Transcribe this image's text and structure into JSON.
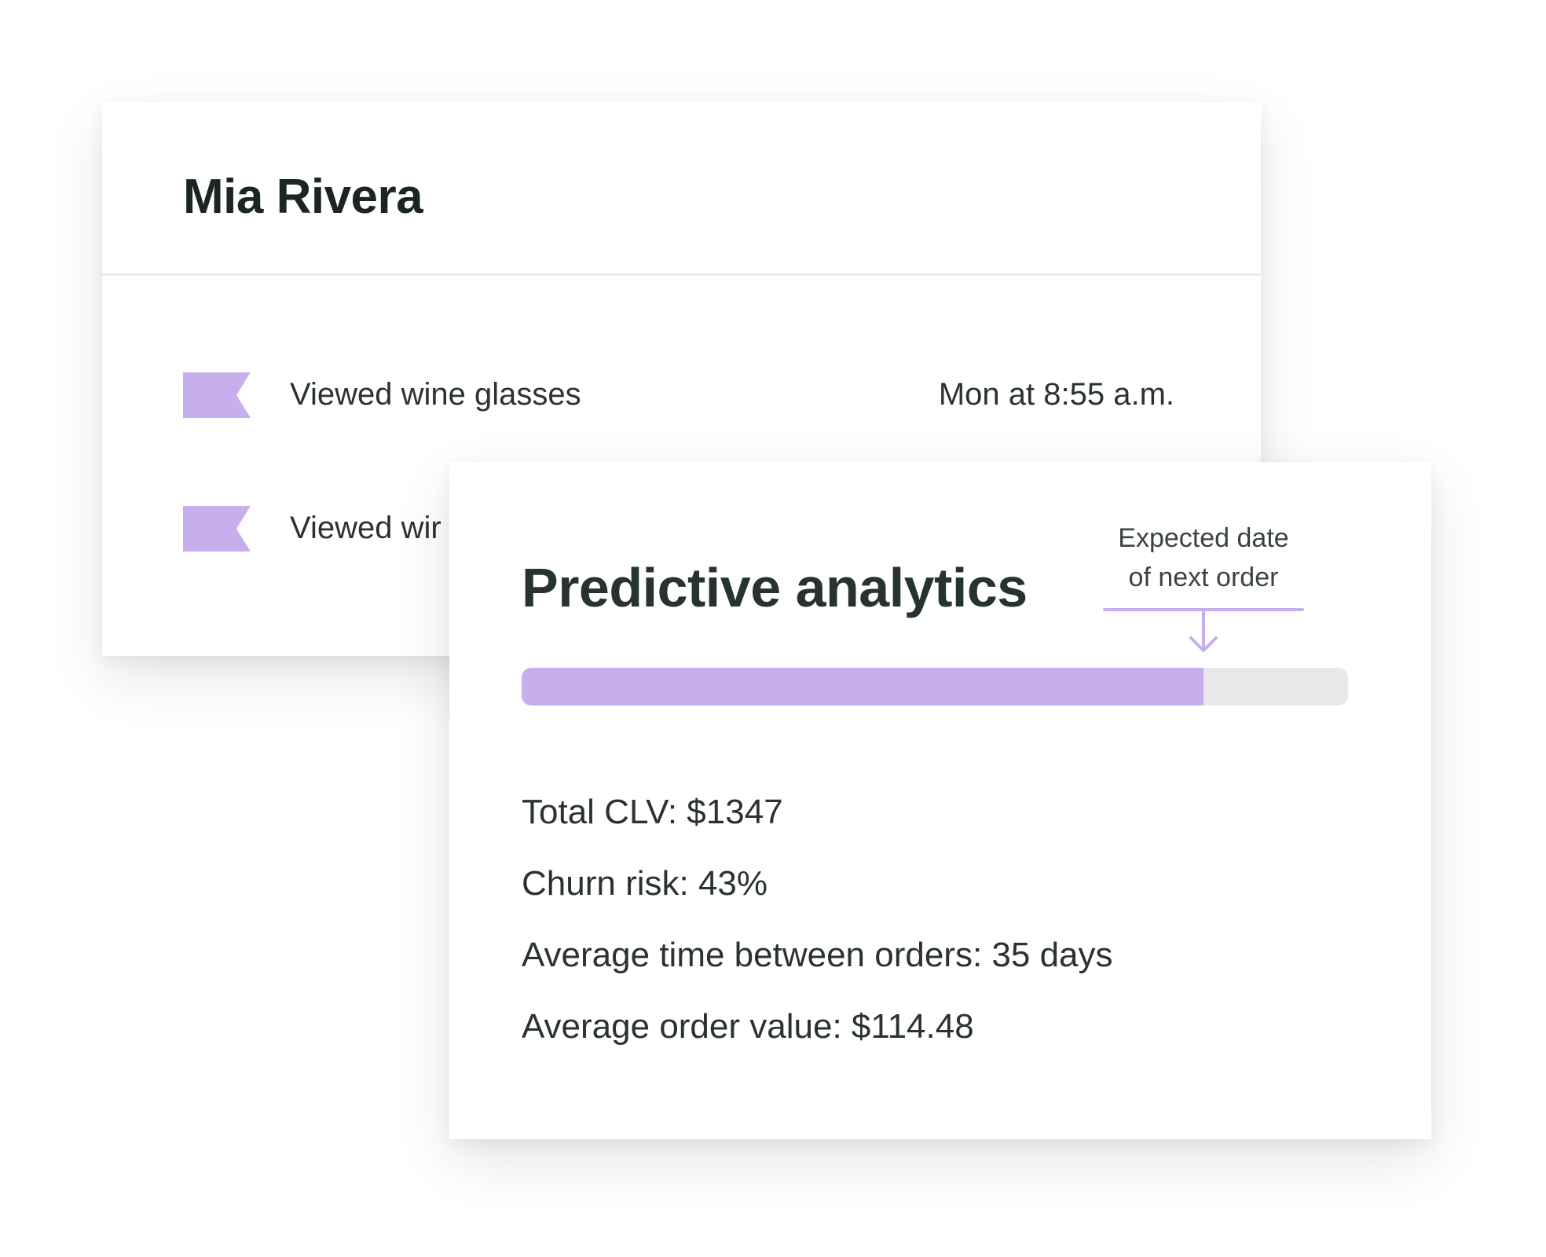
{
  "colors": {
    "accent": "#c7aeec",
    "track": "#e8e8e8",
    "text": "#26342d"
  },
  "profile": {
    "name": "Mia Rivera",
    "activity": [
      {
        "icon": "flag-icon",
        "label": "Viewed wine glasses",
        "time": "Mon at 8:55 a.m."
      },
      {
        "icon": "flag-icon",
        "label": "Viewed wir",
        "time": ""
      }
    ]
  },
  "analytics": {
    "title": "Predictive analytics",
    "expected_label_line1": "Expected date",
    "expected_label_line2": "of next order",
    "progress_fraction": 0.825,
    "metrics": [
      "Total CLV: $1347",
      "Churn risk: 43%",
      "Average time between orders: 35 days",
      "Average order value: $114.48"
    ]
  }
}
